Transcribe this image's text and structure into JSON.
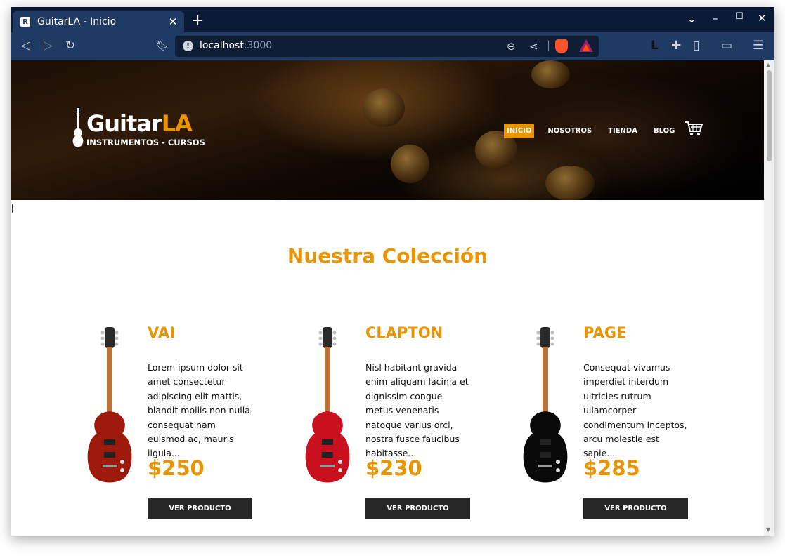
{
  "browser": {
    "tab_title": "GuitarLA - Inicio",
    "url_host": "localhost",
    "url_port": ":3000"
  },
  "site": {
    "logo_word_main": "Guitar",
    "logo_word_accent": "LA",
    "logo_subtitle": "INSTRUMENTOS - CURSOS",
    "nav": [
      {
        "label": "INICIO",
        "active": true
      },
      {
        "label": "NOSOTROS",
        "active": false
      },
      {
        "label": "TIENDA",
        "active": false
      },
      {
        "label": "BLOG",
        "active": false
      }
    ],
    "accent_color": "#e99401"
  },
  "collection": {
    "title": "Nuestra Colección",
    "products": [
      {
        "name": "VAI",
        "description": "Lorem ipsum dolor sit amet consectetur adipiscing elit mattis, blandit mollis non nulla consequat nam euismod ac, mauris ligula...",
        "price": "$250",
        "button": "VER PRODUCTO",
        "guitar_color": "#9e1a0c"
      },
      {
        "name": "CLAPTON",
        "description": "Nisl habitant gravida enim aliquam lacinia et dignissim congue metus venenatis natoque varius orci, nostra fusce faucibus habitasse...",
        "price": "$230",
        "button": "VER PRODUCTO",
        "guitar_color": "#c8101e"
      },
      {
        "name": "PAGE",
        "description": "Consequat vivamus imperdiet interdum ultricies rutrum ullamcorper condimentum inceptos, arcu molestie est sapie...",
        "price": "$285",
        "button": "VER PRODUCTO",
        "guitar_color": "#0a0a0a"
      }
    ]
  }
}
